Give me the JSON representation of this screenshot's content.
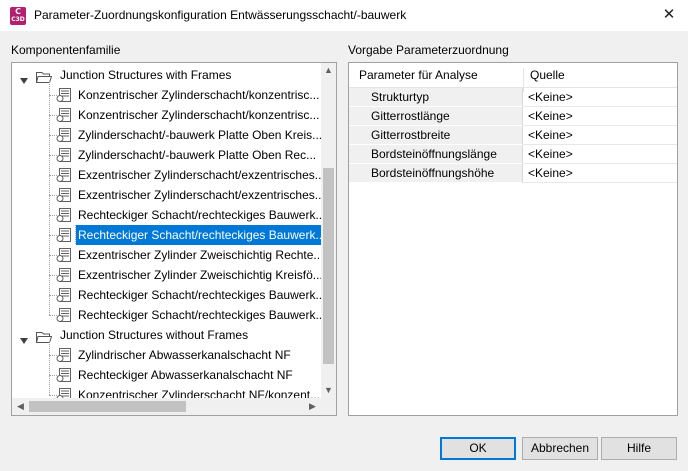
{
  "window": {
    "title": "Parameter-Zuordnungskonfiguration Entwässerungsschacht/-bauwerk",
    "app_icon_text": "C",
    "app_icon_sub": "C3D",
    "close": "✕"
  },
  "left": {
    "label": "Komponentenfamilie",
    "groups": [
      {
        "label": "Junction Structures with Frames",
        "items": [
          "Konzentrischer Zylinderschacht/konzentrisc...",
          "Konzentrischer Zylinderschacht/konzentrisc...",
          "Zylinderschacht/-bauwerk Platte Oben Kreis...",
          "Zylinderschacht/-bauwerk Platte Oben Rec...",
          "Exzentrischer Zylinderschacht/exzentrisches...",
          "Exzentrischer Zylinderschacht/exzentrisches...",
          "Rechteckiger Schacht/rechteckiges Bauwerk...",
          "Rechteckiger Schacht/rechteckiges Bauwerk...",
          "Exzentrischer Zylinder Zweischichtig Rechte...",
          "Exzentrischer Zylinder Zweischichtig Kreisfö...",
          "Rechteckiger Schacht/rechteckiges Bauwerk...",
          "Rechteckiger Schacht/rechteckiges Bauwerk..."
        ]
      },
      {
        "label": "Junction Structures without Frames",
        "items": [
          "Zylindrischer Abwasserkanalschacht NF",
          "Rechteckiger Abwasserkanalschacht NF",
          "Konzentrischer Zylinderschacht NF/konzent..."
        ]
      }
    ],
    "selected_index": 7
  },
  "right": {
    "label": "Vorgabe Parameterzuordnung",
    "columns": [
      "Parameter für Analyse",
      "Quelle"
    ],
    "rows": [
      {
        "param": "Strukturtyp",
        "source": "<Keine>"
      },
      {
        "param": "Gitterrostlänge",
        "source": "<Keine>"
      },
      {
        "param": "Gitterrostbreite",
        "source": "<Keine>"
      },
      {
        "param": "Bordsteinöffnungslänge",
        "source": "<Keine>"
      },
      {
        "param": "Bordsteinöffnungshöhe",
        "source": "<Keine>"
      }
    ]
  },
  "buttons": {
    "ok": "OK",
    "cancel": "Abbrechen",
    "help": "Hilfe"
  },
  "colors": {
    "selection": "#0078d7",
    "app_icon": "#b3206e"
  }
}
